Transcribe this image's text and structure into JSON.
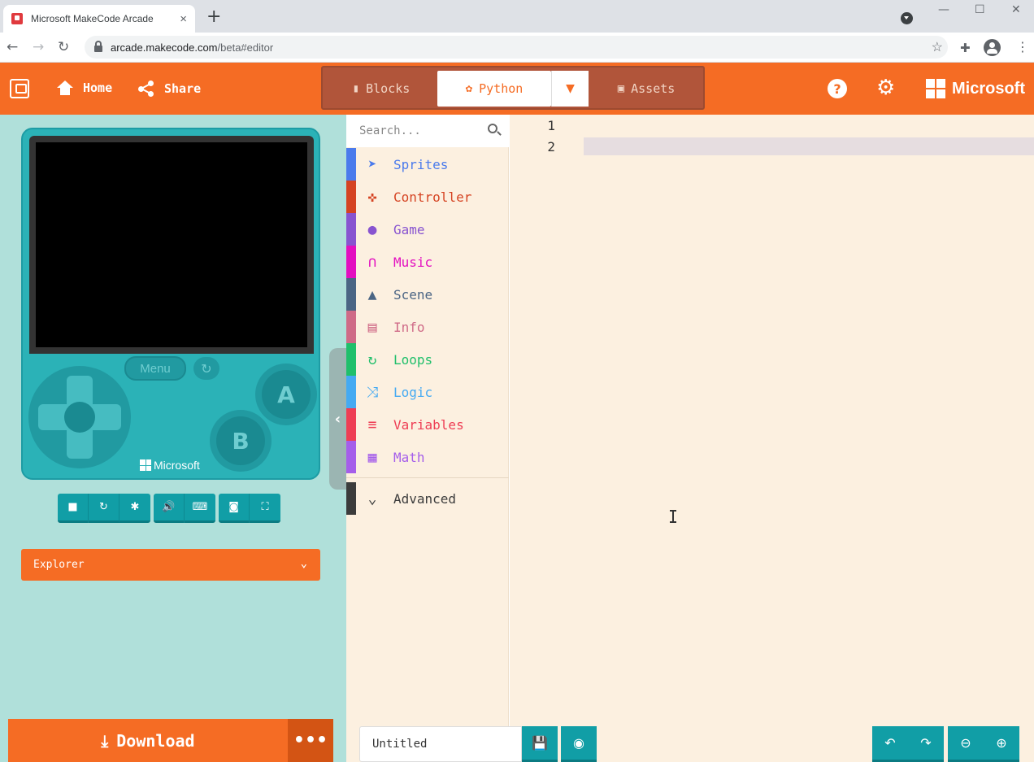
{
  "browser": {
    "tab_title": "Microsoft MakeCode Arcade",
    "tab_close": "×",
    "new_tab": "+",
    "url_host": "arcade.makecode.com",
    "url_path": "/beta#editor",
    "window_minimize": "—",
    "window_maximize": "☐",
    "window_close": "✕"
  },
  "header": {
    "home_label": "Home",
    "share_label": "Share",
    "modes": {
      "blocks": "Blocks",
      "python": "Python",
      "assets": "Assets"
    },
    "active_mode": "Python",
    "help_label": "?",
    "brand": "Microsoft",
    "accent_color": "#f56c24"
  },
  "simulator": {
    "menu_label": "Menu",
    "button_a": "A",
    "button_b": "B",
    "console_brand": "Microsoft",
    "toolbar_icons": [
      "stop-icon",
      "restart-icon",
      "debug-icon",
      "mute-icon",
      "keyboard-icon",
      "screenshot-icon",
      "fullscreen-icon"
    ],
    "explorer_label": "Explorer",
    "download_label": "Download",
    "download_more": "•••"
  },
  "toolbox": {
    "search_placeholder": "Search...",
    "categories": [
      {
        "label": "Sprites",
        "color": "#4b7bec",
        "icon": "paper-plane-icon"
      },
      {
        "label": "Controller",
        "color": "#d54322",
        "icon": "gamepad-icon"
      },
      {
        "label": "Game",
        "color": "#8854d0",
        "icon": "circle-icon"
      },
      {
        "label": "Music",
        "color": "#e30fc0",
        "icon": "headphones-icon"
      },
      {
        "label": "Scene",
        "color": "#4b6584",
        "icon": "tree-icon"
      },
      {
        "label": "Info",
        "color": "#cf6a87",
        "icon": "id-card-icon"
      },
      {
        "label": "Loops",
        "color": "#20bf6b",
        "icon": "refresh-icon"
      },
      {
        "label": "Logic",
        "color": "#45aaf2",
        "icon": "shuffle-icon"
      },
      {
        "label": "Variables",
        "color": "#ee3d54",
        "icon": "list-icon"
      },
      {
        "label": "Math",
        "color": "#a55eea",
        "icon": "calculator-icon"
      }
    ],
    "advanced_label": "Advanced",
    "advanced_color": "#3c3c3c"
  },
  "editor": {
    "line_numbers": [
      "1",
      "2"
    ]
  },
  "footer": {
    "project_name": "Untitled"
  }
}
